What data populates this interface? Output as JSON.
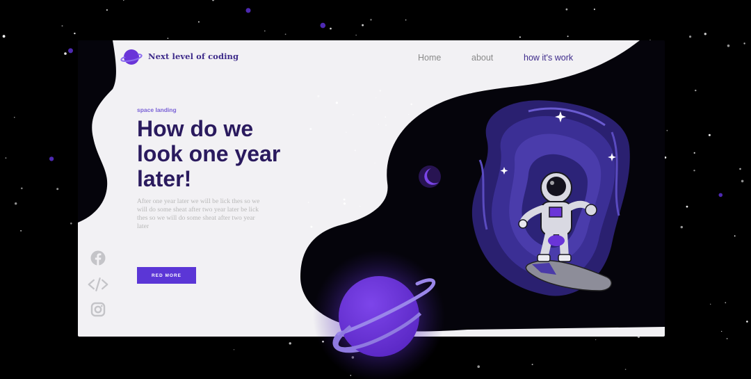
{
  "brand": {
    "name": "Next level of coding",
    "logo_icon": "planet-logo-icon"
  },
  "nav": {
    "items": [
      {
        "label": "Home",
        "active": false
      },
      {
        "label": "about",
        "active": false
      },
      {
        "label": "how it's work",
        "active": true
      }
    ]
  },
  "hero": {
    "eyebrow": "space landing",
    "headline": "How do we look one year later!",
    "body": "After one year later we will be lick thes so we will do some sheat after two year later be lick thes so we will do some sheat after two year later",
    "cta_label": "RED MORE"
  },
  "social": [
    {
      "icon": "facebook-icon"
    },
    {
      "icon": "code-icon"
    },
    {
      "icon": "instagram-icon"
    }
  ],
  "colors": {
    "accent": "#5b36d6",
    "heading": "#2a1a5e",
    "card": "#f2f1f4",
    "space": "#05040b",
    "planet": "#6a35d8"
  }
}
